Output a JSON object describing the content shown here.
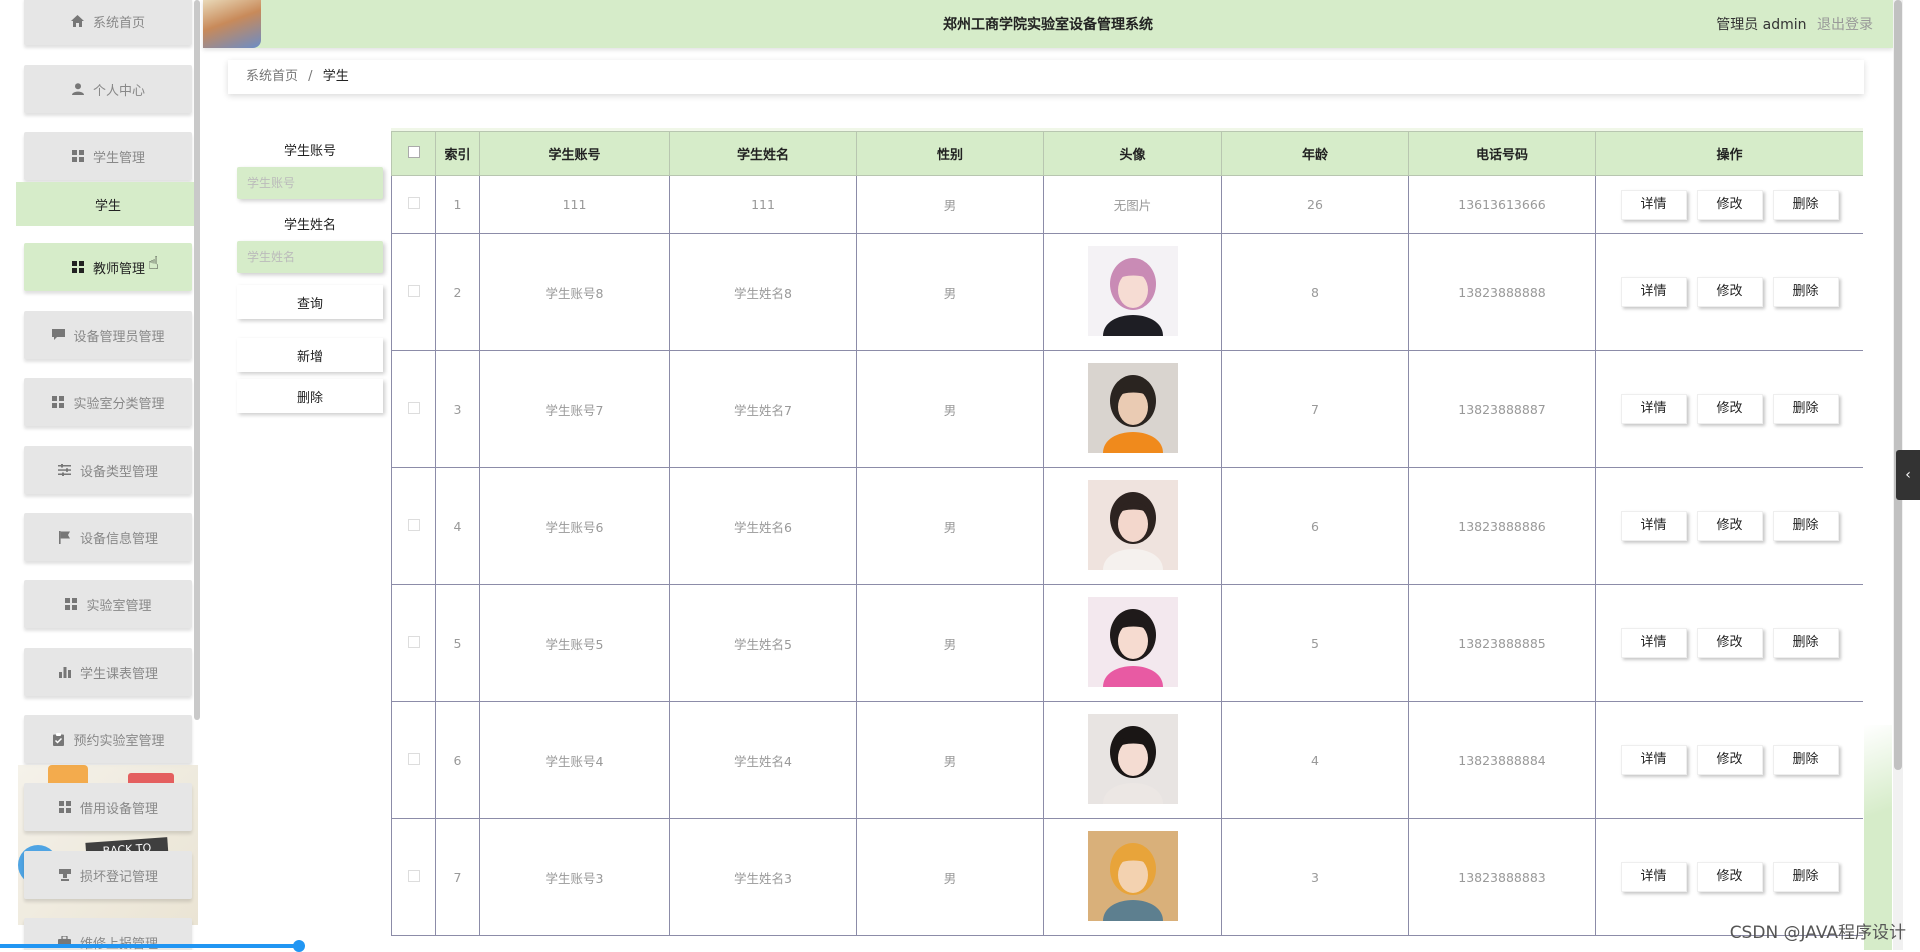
{
  "header": {
    "title": "郑州工商学院实验室设备管理系统",
    "user": "管理员 admin",
    "logout": "退出登录"
  },
  "sidebar": {
    "items": [
      {
        "label": "系统首页",
        "icon": "home-icon"
      },
      {
        "label": "个人中心",
        "icon": "user-icon"
      },
      {
        "label": "学生管理",
        "icon": "grid-icon"
      },
      {
        "label": "教师管理",
        "icon": "grid-icon"
      },
      {
        "label": "设备管理员管理",
        "icon": "chat-icon"
      },
      {
        "label": "实验室分类管理",
        "icon": "grid-icon"
      },
      {
        "label": "设备类型管理",
        "icon": "sliders-icon"
      },
      {
        "label": "设备信息管理",
        "icon": "flag-icon"
      },
      {
        "label": "实验室管理",
        "icon": "grid-icon"
      },
      {
        "label": "学生课表管理",
        "icon": "bar-chart-icon"
      },
      {
        "label": "预约实验室管理",
        "icon": "clipboard-icon"
      },
      {
        "label": "借用设备管理",
        "icon": "grid-icon"
      },
      {
        "label": "损坏登记管理",
        "icon": "stamp-icon"
      },
      {
        "label": "维修上报管理",
        "icon": "briefcase-icon"
      }
    ],
    "submenu_active": "学生",
    "hover_item": "教师管理"
  },
  "breadcrumb": {
    "home": "系统首页",
    "separator": "/",
    "current": "学生"
  },
  "search": {
    "account_label": "学生账号",
    "account_placeholder": "学生账号",
    "name_label": "学生姓名",
    "name_placeholder": "学生姓名",
    "query_button": "查询",
    "add_button": "新增",
    "delete_button": "删除"
  },
  "table": {
    "headers": [
      "",
      "索引",
      "学生账号",
      "学生姓名",
      "性别",
      "头像",
      "年龄",
      "电话号码",
      "操作"
    ],
    "actions": {
      "detail": "详情",
      "edit": "修改",
      "delete": "删除"
    },
    "no_image_text": "无图片",
    "rows": [
      {
        "index": "1",
        "account": "111",
        "name": "111",
        "gender": "男",
        "avatar": "none",
        "age": "26",
        "phone": "13613613666"
      },
      {
        "index": "2",
        "account": "学生账号8",
        "name": "学生姓名8",
        "gender": "男",
        "avatar": "girl-pink-hair",
        "age": "8",
        "phone": "13823888888"
      },
      {
        "index": "3",
        "account": "学生账号7",
        "name": "学生姓名7",
        "gender": "男",
        "avatar": "boy-orange-shirt",
        "age": "7",
        "phone": "13823888887"
      },
      {
        "index": "4",
        "account": "学生账号6",
        "name": "学生姓名6",
        "gender": "男",
        "avatar": "girl-hand-face",
        "age": "6",
        "phone": "13823888886"
      },
      {
        "index": "5",
        "account": "学生账号5",
        "name": "学生姓名5",
        "gender": "男",
        "avatar": "girl-pink-hoodie",
        "age": "5",
        "phone": "13823888885"
      },
      {
        "index": "6",
        "account": "学生账号4",
        "name": "学生姓名4",
        "gender": "男",
        "avatar": "girl-selfie",
        "age": "4",
        "phone": "13823888884"
      },
      {
        "index": "7",
        "account": "学生账号3",
        "name": "学生姓名3",
        "gender": "男",
        "avatar": "anime-boy",
        "age": "3",
        "phone": "13823888883"
      }
    ]
  },
  "watermark": "CSDN @JAVA程序设计",
  "colors": {
    "accent": "#d6ecc9",
    "menu_bg": "#e6e6e6",
    "text_muted": "#999999"
  }
}
